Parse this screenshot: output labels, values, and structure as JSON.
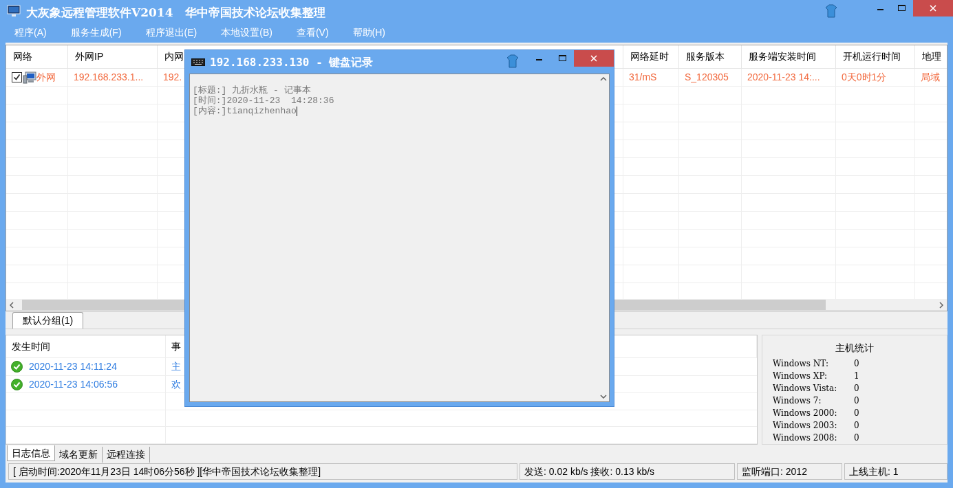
{
  "window": {
    "title": "大灰象远程管理软件V2014　华中帝国技术论坛收集整理"
  },
  "menu": [
    "程序(A)",
    "服务生成(F)",
    "程序退出(E)",
    "本地设置(B)",
    "查看(V)",
    "帮助(H)"
  ],
  "hosts_table": {
    "columns": [
      "网络",
      "外网IP",
      "内网",
      "网络延时",
      "服务版本",
      "服务端安装时间",
      "开机运行时间",
      "地理"
    ],
    "rows": [
      {
        "checked": true,
        "cells": [
          "外网",
          "192.168.233.1...",
          "192.",
          "31/mS",
          "S_120305",
          "2020-11-23 14:...",
          "0天0时1分",
          "局域"
        ]
      }
    ]
  },
  "group_tabs": [
    {
      "label": "默认分组(1)",
      "selected": true
    }
  ],
  "log_table": {
    "columns": [
      "发生时间",
      "事"
    ],
    "rows": [
      {
        "kind": "ok",
        "time": "2020-11-23 14:11:24",
        "event": "主"
      },
      {
        "kind": "ok",
        "time": "2020-11-23 14:06:56",
        "event": "欢"
      }
    ]
  },
  "host_stats": {
    "title": "主机统计",
    "items": [
      {
        "label": "Windows NT:",
        "value": "0"
      },
      {
        "label": "Windows XP:",
        "value": "1"
      },
      {
        "label": "Windows Vista:",
        "value": "0"
      },
      {
        "label": "Windows 7:",
        "value": "0"
      },
      {
        "label": "Windows 2000:",
        "value": "0"
      },
      {
        "label": "Windows 2003:",
        "value": "0"
      },
      {
        "label": "Windows 2008:",
        "value": "0"
      }
    ]
  },
  "bottom_tabs": [
    {
      "label": "日志信息",
      "selected": true
    },
    {
      "label": "域名更新",
      "selected": false
    },
    {
      "label": "远程连接",
      "selected": false
    }
  ],
  "status_bar": [
    "[ 启动时间:2020年11月23日 14时06分56秒 ][华中帝国技术论坛收集整理]",
    "发送: 0.02 kb/s 接收: 0.13 kb/s",
    "监听端口: 2012",
    "上线主机: 1"
  ],
  "dialog": {
    "title": "192.168.233.130 - 键盘记录",
    "lines": [
      "[标题:] 九折水瓶 - 记事本",
      "[时间:]2020-11-23  14:28:36",
      "[内容:]tianqizhenhao"
    ]
  }
}
